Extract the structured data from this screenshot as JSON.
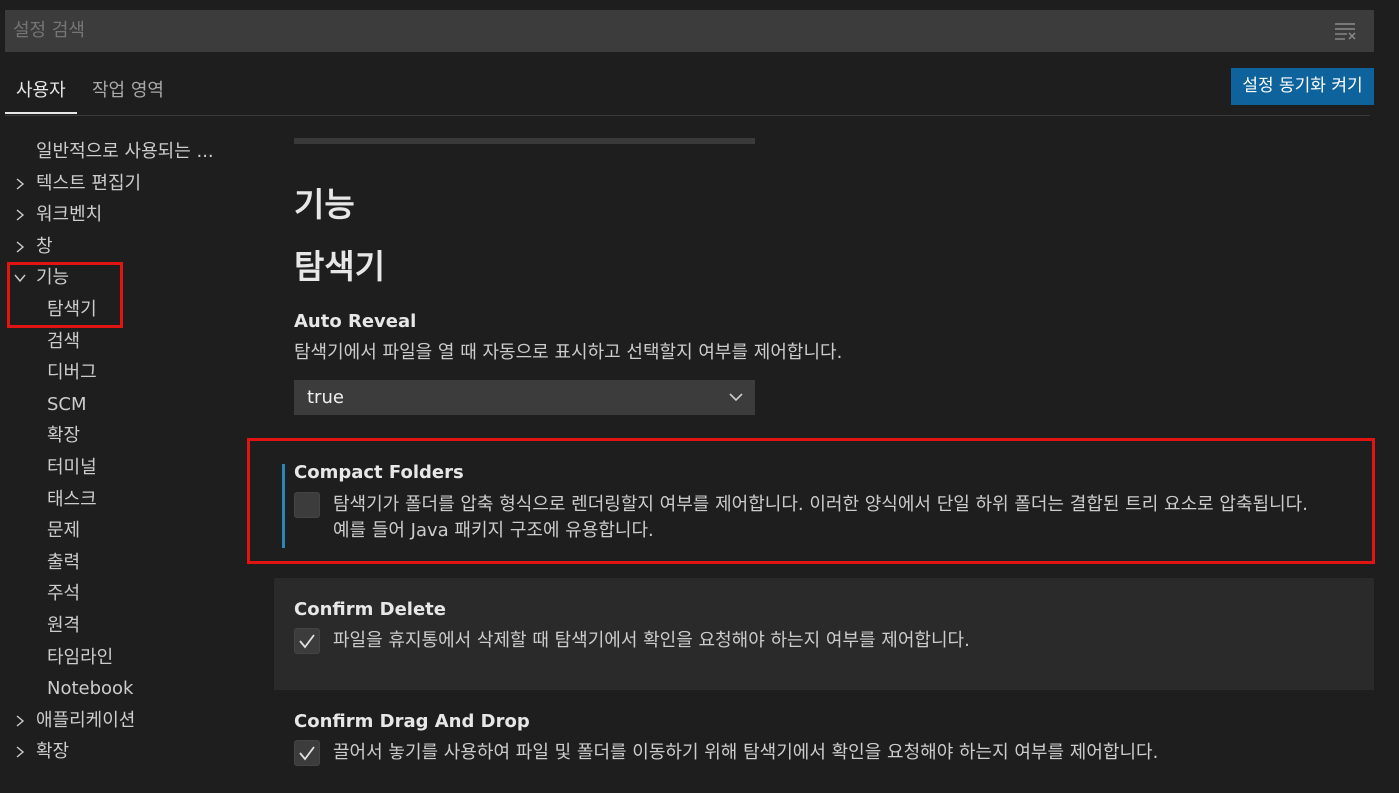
{
  "search": {
    "placeholder": "설정 검색"
  },
  "tabs": {
    "user": "사용자",
    "workspace": "작업 영역"
  },
  "sync_button": "설정 동기화 켜기",
  "toc": [
    {
      "label": "일반적으로 사용되는 ...",
      "expand": "none"
    },
    {
      "label": "텍스트 편집기",
      "expand": "collapsed"
    },
    {
      "label": "워크벤치",
      "expand": "collapsed"
    },
    {
      "label": "창",
      "expand": "collapsed"
    },
    {
      "label": "기능",
      "expand": "expanded"
    },
    {
      "label": "탐색기",
      "expand": "child"
    },
    {
      "label": "검색",
      "expand": "child"
    },
    {
      "label": "디버그",
      "expand": "child"
    },
    {
      "label": "SCM",
      "expand": "child"
    },
    {
      "label": "확장",
      "expand": "child"
    },
    {
      "label": "터미널",
      "expand": "child"
    },
    {
      "label": "태스크",
      "expand": "child"
    },
    {
      "label": "문제",
      "expand": "child"
    },
    {
      "label": "출력",
      "expand": "child"
    },
    {
      "label": "주석",
      "expand": "child"
    },
    {
      "label": "원격",
      "expand": "child"
    },
    {
      "label": "타임라인",
      "expand": "child"
    },
    {
      "label": "Notebook",
      "expand": "child"
    },
    {
      "label": "애플리케이션",
      "expand": "collapsed"
    },
    {
      "label": "확장",
      "expand": "collapsed"
    }
  ],
  "main": {
    "section_title": "기능",
    "subsection_title": "탐색기",
    "auto_reveal": {
      "title": "Auto Reveal",
      "description": "탐색기에서 파일을 열 때 자동으로 표시하고 선택할지 여부를 제어합니다.",
      "value": "true"
    },
    "compact_folders": {
      "title": "Compact Folders",
      "description_line1": "탐색기가 폴더를 압축 형식으로 렌더링할지 여부를 제어합니다. 이러한 양식에서 단일 하위 폴더는 결합된 트리 요소로 압축됩니다.",
      "description_line2": "예를 들어 Java 패키지 구조에 유용합니다.",
      "checked": false
    },
    "confirm_delete": {
      "title": "Confirm Delete",
      "description": "파일을 휴지통에서 삭제할 때 탐색기에서 확인을 요청해야 하는지 여부를 제어합니다.",
      "checked": true
    },
    "confirm_drag_drop": {
      "title": "Confirm Drag And Drop",
      "description": "끌어서 놓기를 사용하여 파일 및 폴더를 이동하기 위해 탐색기에서 확인을 요청해야 하는지 여부를 제어합니다.",
      "checked": true
    }
  },
  "colors": {
    "accent": "#0e639c",
    "highlight": "#e11414",
    "focus": "#2b88b5"
  }
}
